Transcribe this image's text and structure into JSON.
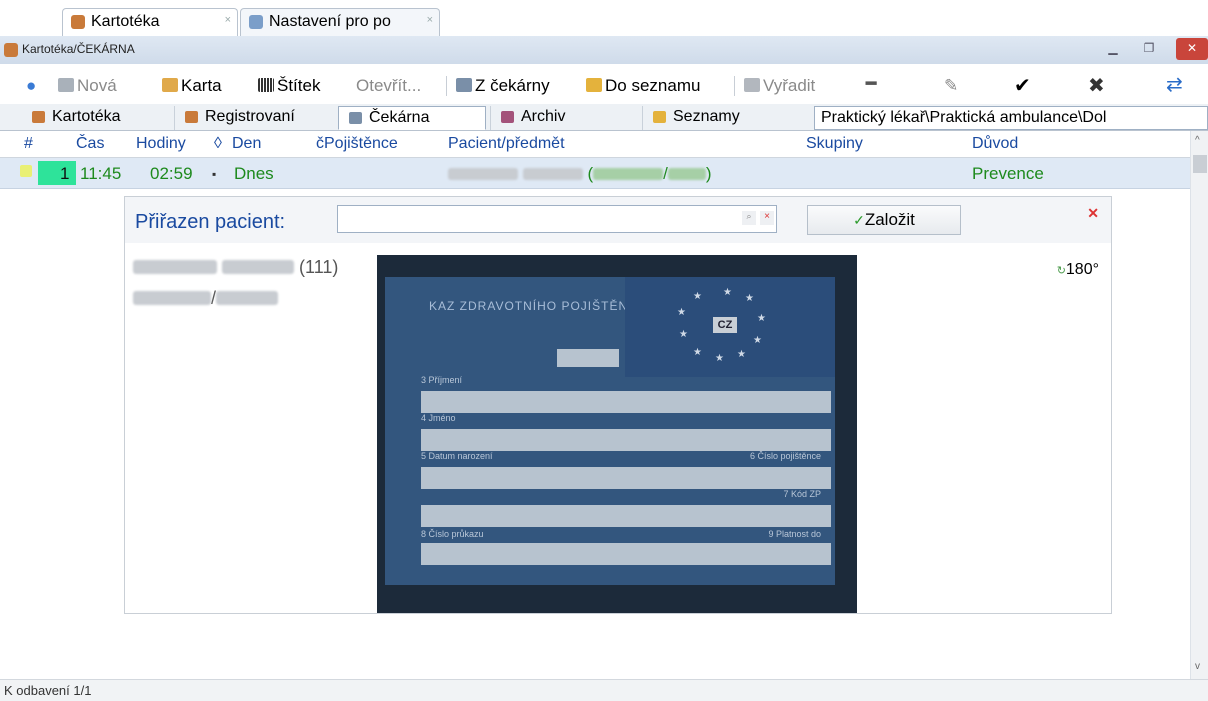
{
  "doc_tabs": [
    {
      "label": "Kartotéka",
      "active": true
    },
    {
      "label": "Nastavení pro po",
      "active": false
    }
  ],
  "window": {
    "title": "Kartotéka/ČEKÁRNA"
  },
  "toolbar": {
    "new_label": "Nová",
    "card_label": "Karta",
    "label_label": "Štítek",
    "open_label": "Otevřít...",
    "from_waiting_label": "Z čekárny",
    "to_list_label": "Do seznamu",
    "discard_label": "Vyřadit"
  },
  "tabs": [
    "Kartotéka",
    "Registrovaní",
    "Čekárna",
    "Archiv",
    "Seznamy"
  ],
  "active_tab": "Čekárna",
  "path_select": "Praktický lékař\\Praktická ambulance\\Dol",
  "grid": {
    "columns": [
      "#",
      "Čas",
      "Hodiny",
      "◊",
      "Den",
      "čPojištěnce",
      "Pacient/předmět",
      "Skupiny",
      "Důvod"
    ],
    "rows": [
      {
        "num": "1",
        "time": "11:45",
        "hours": "02:59",
        "day": "Dnes",
        "reason": "Prevence"
      }
    ]
  },
  "panel": {
    "assign_label": "Přiřazen pacient:",
    "create_label": "Založit",
    "patient_code": "(111)",
    "rotate_label": "180°"
  },
  "card": {
    "header": "KAZ ZDRAVOTNÍHO POJIŠTĚNÍ",
    "country": "CZ",
    "field_surname": "3 Příjmení",
    "field_name": "4 Jméno",
    "field_birth": "5 Datum narození",
    "field_insurance_no": "6 Číslo pojištěnce",
    "field_code": "7 Kód ZP",
    "field_card_no": "8 Číslo průkazu",
    "field_valid": "9 Platnost do"
  },
  "status": {
    "text": "K odbavení 1/1"
  },
  "colors": {
    "accent": "#1a4aa0",
    "row_text": "#1d8a1d",
    "selected_num": "#2ee39a",
    "close": "#d33"
  }
}
